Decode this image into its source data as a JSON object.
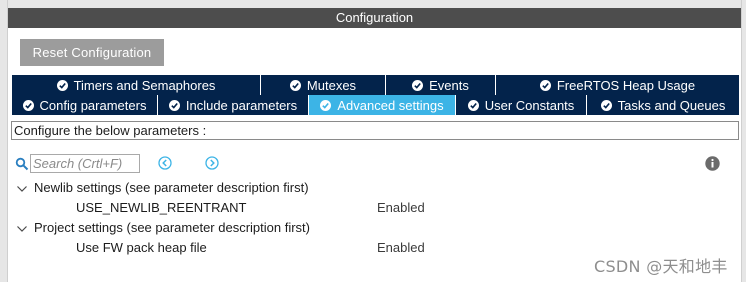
{
  "panel": {
    "title": "Configuration"
  },
  "reset_button": {
    "label": "Reset Configuration"
  },
  "tabs": {
    "row1": [
      {
        "label": "Timers and Semaphores"
      },
      {
        "label": "Mutexes"
      },
      {
        "label": "Events"
      },
      {
        "label": "FreeRTOS Heap Usage"
      }
    ],
    "row2": [
      {
        "label": "Config parameters"
      },
      {
        "label": "Include parameters"
      },
      {
        "label": "Advanced settings",
        "active": true
      },
      {
        "label": "User Constants"
      },
      {
        "label": "Tasks and Queues"
      }
    ]
  },
  "description": {
    "text": "Configure the below parameters :"
  },
  "search": {
    "placeholder": "Search (Crtl+F)"
  },
  "icons": {
    "search": "search-icon",
    "prev": "chevron-left-circle-icon",
    "next": "chevron-right-circle-icon",
    "info": "info-icon",
    "tab_check": "check-circle-icon",
    "expand": "chevron-down-icon"
  },
  "tree": [
    {
      "group": "Newlib settings (see parameter description first)",
      "params": [
        {
          "name": "USE_NEWLIB_REENTRANT",
          "value": "Enabled"
        }
      ]
    },
    {
      "group": "Project settings (see parameter description first)",
      "params": [
        {
          "name": "Use FW pack heap file",
          "value": "Enabled"
        }
      ]
    }
  ],
  "watermark": {
    "text": "CSDN @天和地丰"
  },
  "colors": {
    "title_bar": "#4d4d4d",
    "tab_bg": "#03234b",
    "tab_active": "#3cb4e6",
    "button_bg": "#9c9c9c",
    "nav_accent": "#3cb4e6"
  }
}
